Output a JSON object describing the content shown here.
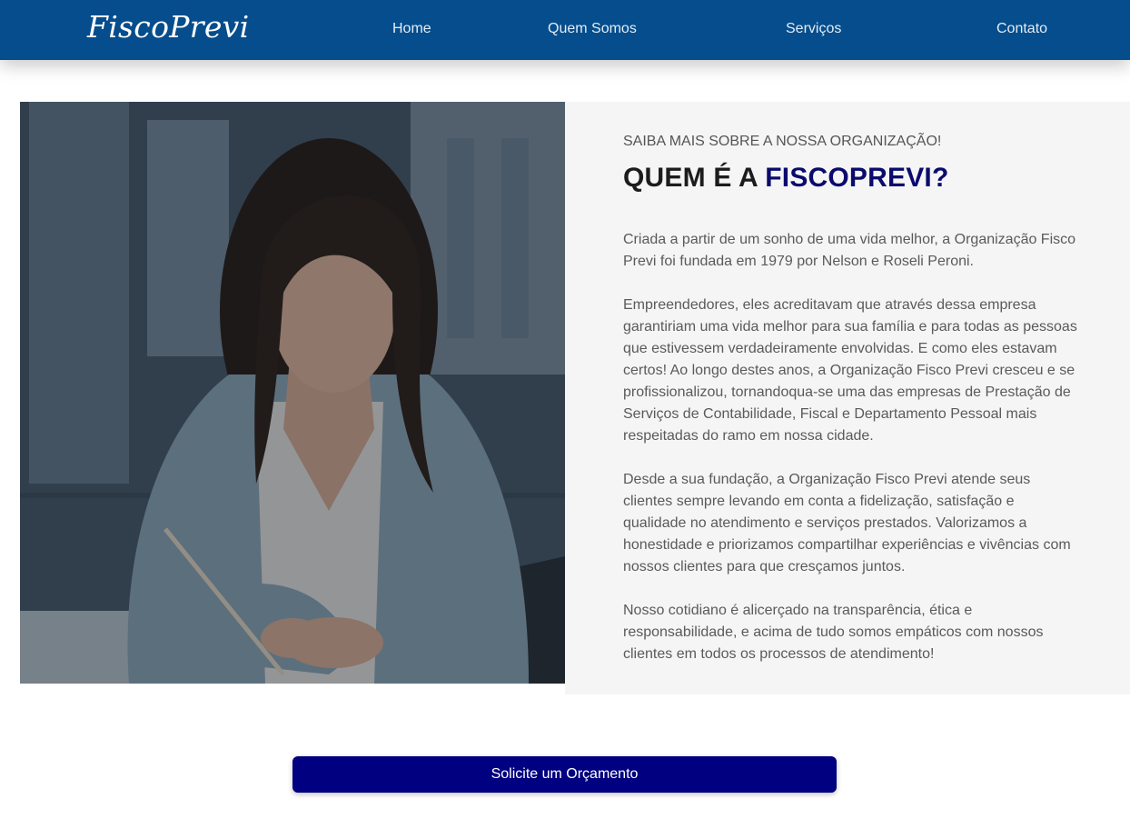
{
  "header": {
    "logo": "FiscoPrevi",
    "nav": [
      "Home",
      "Quem Somos",
      "Serviços",
      "Contato"
    ]
  },
  "about": {
    "kicker": "SAIBA MAIS SOBRE A NOSSA ORGANIZAÇÃO!",
    "title_prefix": "QUEM É A ",
    "title_brand": "FISCOPREVI?",
    "paragraphs": [
      "Criada a partir de um sonho de uma vida melhor, a Organização Fisco Previ foi fundada em 1979 por Nelson e Roseli Peroni.",
      "Empreendedores, eles acreditavam que através dessa empresa garantiriam uma vida melhor para sua família e para todas as pessoas que estivessem verdadeiramente envolvidas. E como eles estavam certos! Ao longo destes anos, a Organização Fisco Previ cresceu e se profissionalizou, tornandoqua-se uma das empresas de Prestação de Serviços de Contabilidade, Fiscal e Departamento Pessoal mais respeitadas do ramo em nossa cidade.",
      "Desde a sua fundação, a Organização Fisco Previ atende seus clientes sempre levando em conta a fidelização, satisfação e qualidade no atendimento e serviços prestados. Valorizamos a honestidade e priorizamos compartilhar experiências e vivências com nossos clientes para que cresçamos juntos.",
      "Nosso cotidiano é alicerçado na transparência, ética e responsabilidade, e acima de tudo somos empáticos com nossos clientes em todos os processos de atendimento!"
    ]
  },
  "cta": {
    "label": "Solicite um Orçamento"
  },
  "colors": {
    "navbar": "#054d8c",
    "brand_text": "#0b0b6e",
    "cta_background": "#000080",
    "about_background": "#f5f5f5"
  },
  "photo": {
    "subject": "woman-writing-at-desk"
  }
}
